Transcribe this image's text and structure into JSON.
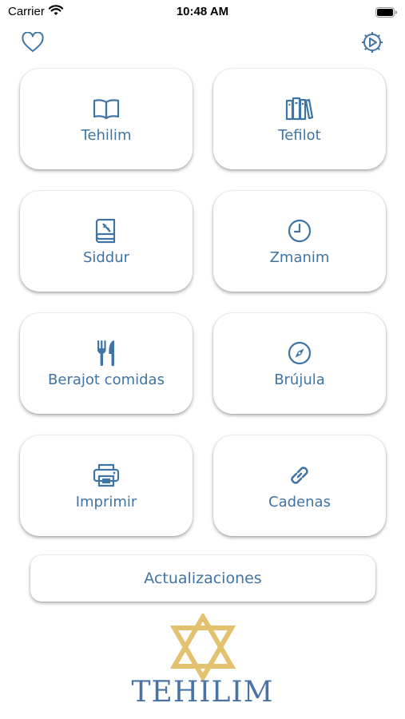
{
  "status_bar": {
    "carrier": "Carrier",
    "time": "10:48 AM"
  },
  "header": {
    "favorites_icon": "heart-icon",
    "settings_icon": "gear-icon"
  },
  "menu": {
    "items": [
      {
        "label": "Tehilim",
        "icon": "book-open-icon"
      },
      {
        "label": "Tefilot",
        "icon": "books-icon"
      },
      {
        "label": "Siddur",
        "icon": "siddur-book-icon"
      },
      {
        "label": "Zmanim",
        "icon": "clock-icon"
      },
      {
        "label": "Berajot comidas",
        "icon": "fork-knife-icon"
      },
      {
        "label": "Brújula",
        "icon": "compass-icon"
      },
      {
        "label": "Imprimir",
        "icon": "printer-icon"
      },
      {
        "label": "Cadenas",
        "icon": "link-icon"
      }
    ]
  },
  "updates_button": {
    "label": "Actualizaciones"
  },
  "logo": {
    "text": "TEHILIM"
  },
  "colors": {
    "accent": "#3f74a4",
    "star_gold": "#e3c26f"
  }
}
